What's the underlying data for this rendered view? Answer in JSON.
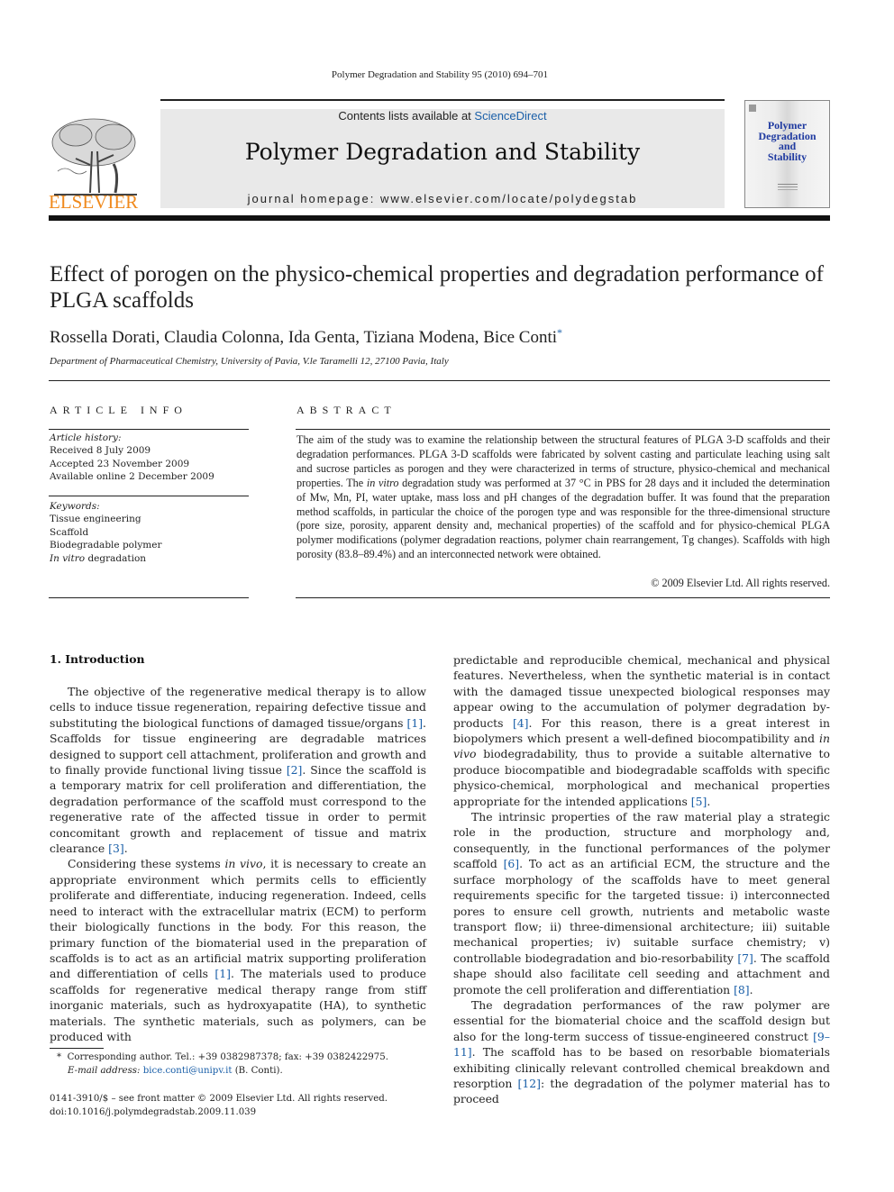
{
  "running_head": "Polymer Degradation and Stability 95 (2010) 694–701",
  "masthead": {
    "publisher_logo_word": "ELSEVIER",
    "contents_prefix": "Contents lists available at ",
    "contents_link": "ScienceDirect",
    "journal_title": "Polymer Degradation and Stability",
    "homepage": "journal homepage: www.elsevier.com/locate/polydegstab",
    "cover_title_lines": [
      "Polymer",
      "Degradation",
      "and",
      "Stability"
    ]
  },
  "colors": {
    "link": "#1a5fa8",
    "elsevier_orange": "#f08a1d",
    "masthead_bg": "#e9e9e9",
    "cover_title": "#1f3aa0"
  },
  "article": {
    "title": "Effect of porogen on the physico-chemical properties and degradation performance of PLGA scaffolds",
    "authors": "Rossella Dorati, Claudia Colonna, Ida Genta, Tiziana Modena, Bice Conti",
    "corresponding_marker": "*",
    "affiliation": "Department of Pharmaceutical Chemistry, University of Pavia, V.le Taramelli 12, 27100 Pavia, Italy"
  },
  "article_info": {
    "heading": "ARTICLE INFO",
    "history_label": "Article history:",
    "history": [
      "Received 8 July 2009",
      "Accepted 23 November 2009",
      "Available online 2 December 2009"
    ],
    "keywords_label": "Keywords:",
    "keywords": [
      "Tissue engineering",
      "Scaffold",
      "Biodegradable polymer"
    ],
    "keyword_last_italic": "In vitro",
    "keyword_last_rest": " degradation"
  },
  "abstract": {
    "heading": "ABSTRACT",
    "part1": "The aim of the study was to examine the relationship between the structural features of PLGA 3-D scaffolds and their degradation performances. PLGA 3-D scaffolds were fabricated by solvent casting and particulate leaching using salt and sucrose particles as porogen and they were characterized in terms of structure, physico-chemical and mechanical properties. The ",
    "italic": "in vitro",
    "part2": " degradation study was performed at 37 °C in PBS for 28 days and it included the determination of Mw, Mn, PI, water uptake, mass loss and pH changes of the degradation buffer. It was found that the preparation method scaffolds, in particular the choice of the porogen type and was responsible for the three-dimensional structure (pore size, porosity, apparent density and, mechanical properties) of the scaffold and for physico-chemical PLGA polymer modifications (polymer degradation reactions, polymer chain rearrangement, Tg changes). Scaffolds with high porosity (83.8–89.4%) and an interconnected network were obtained.",
    "copyright": "© 2009 Elsevier Ltd. All rights reserved."
  },
  "body": {
    "section_title": "1.  Introduction",
    "left": {
      "p1": [
        "The objective of the regenerative medical therapy is to allow cells to induce tissue regeneration, repairing defective tissue and substituting the biological functions of damaged tissue/organs ",
        "[1]",
        ". Scaffolds for tissue engineering are degradable matrices designed to support cell attachment, proliferation and growth and to finally provide functional living tissue ",
        "[2]",
        ". Since the scaffold is a temporary matrix for cell proliferation and differentiation, the degradation performance of the scaffold must correspond to the regenerative rate of the affected tissue in order to permit concomitant growth and replacement of tissue and matrix clearance ",
        "[3]",
        "."
      ],
      "p2": [
        "Considering these systems ",
        "in vivo",
        ", it is necessary to create an appropriate environment which permits cells to efficiently proliferate and differentiate, inducing regeneration. Indeed, cells need to interact with the extracellular matrix (ECM) to perform their biologically functions in the body. For this reason, the primary function of the biomaterial used in the preparation of scaffolds is to act as an artificial matrix supporting proliferation and differentiation of cells ",
        "[1]",
        ". The materials used to produce scaffolds for regenerative medical therapy range from stiff inorganic materials, such as hydroxyapatite (HA), to synthetic materials. The synthetic materials, such as polymers, can be produced with"
      ]
    },
    "right": {
      "p1": [
        "predictable and reproducible chemical, mechanical and physical features. Nevertheless, when the synthetic material is in contact with the damaged tissue unexpected biological responses may appear owing to the accumulation of polymer degradation by-products ",
        "[4]",
        ". For this reason, there is a great interest in biopolymers which present a well-defined biocompatibility and ",
        "in vivo",
        " biodegradability, thus to provide a suitable alternative to produce biocompatible and biodegradable scaffolds with specific physico-chemical, morphological and mechanical properties appropriate for the intended applications ",
        "[5]",
        "."
      ],
      "p2": [
        "The intrinsic properties of the raw material play a strategic role in the production, structure and morphology and, consequently, in the functional performances of the polymer scaffold ",
        "[6]",
        ". To act as an artificial ECM, the structure and the surface morphology of the scaffolds have to meet general requirements specific for the targeted tissue: i) interconnected pores to ensure cell growth, nutrients and metabolic waste transport flow; ii) three-dimensional architecture; iii) suitable mechanical properties; iv) suitable surface chemistry; v) controllable biodegradation and bio-resorbability ",
        "[7]",
        ". The scaffold shape should also facilitate cell seeding and attachment and promote the cell proliferation and differentiation ",
        "[8]",
        "."
      ],
      "p3": [
        "The degradation performances of the raw polymer are essential for the biomaterial choice and the scaffold design but also for the long-term success of tissue-engineered construct ",
        "[9–11]",
        ". The scaffold has to be based on resorbable biomaterials exhibiting clinically relevant controlled chemical breakdown and resorption ",
        "[12]",
        ": the degradation of the polymer material has to proceed"
      ]
    }
  },
  "footnote": {
    "marker": "*",
    "corresponding": "Corresponding author. Tel.: +39 0382987378; fax: +39 0382422975.",
    "email_label": "E-mail address:",
    "email": "bice.conti@unipv.it",
    "email_suffix": " (B. Conti)."
  },
  "front_matter": {
    "issn": "0141-3910/$ – see front matter © 2009 Elsevier Ltd. All rights reserved.",
    "doi": "doi:10.1016/j.polymdegradstab.2009.11.039"
  }
}
